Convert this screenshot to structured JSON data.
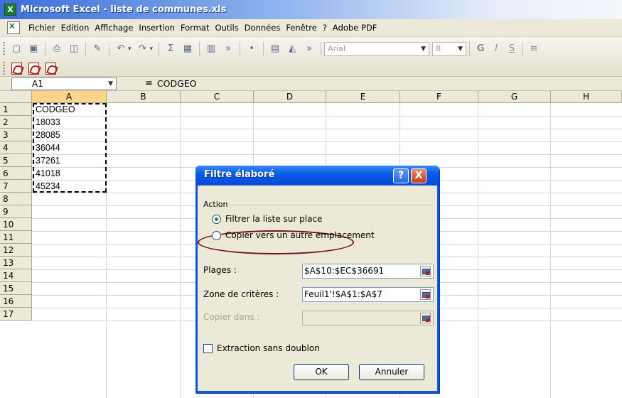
{
  "window": {
    "title": "Microsoft Excel - liste de communes.xls"
  },
  "menu": [
    "Fichier",
    "Edition",
    "Affichage",
    "Insertion",
    "Format",
    "Outils",
    "Données",
    "Fenêtre",
    "?",
    "Adobe PDF"
  ],
  "toolbar": {
    "font": "Arial",
    "size": "8",
    "bold": "G",
    "italic": "I",
    "underline": "S"
  },
  "formula_bar": {
    "cell_ref": "A1",
    "equals": "=",
    "value": "CODGEO"
  },
  "columns": [
    "A",
    "B",
    "C",
    "D",
    "E",
    "F",
    "G",
    "H"
  ],
  "rows": [
    "1",
    "2",
    "3",
    "4",
    "5",
    "6",
    "7",
    "8",
    "9",
    "10",
    "11",
    "12",
    "13",
    "14",
    "15",
    "16",
    "17"
  ],
  "cells": [
    "CODGEO",
    "18033",
    "28085",
    "36044",
    "37261",
    "41018",
    "45234"
  ],
  "dialog": {
    "title": "Filtre élaboré",
    "help": "?",
    "close": "X",
    "action_label": "Action",
    "radio1": "Filtrer la liste sur place",
    "radio2": "Copier vers un autre emplacement",
    "plages_label": "Plages :",
    "plages_value": "$A$10:$EC$36691",
    "criteres_label": "Zone de critères :",
    "criteres_value": "Feuil1'!$A$1:$A$7",
    "copier_label": "Copier dans :",
    "copier_value": "",
    "extraction_label": "Extraction sans doublon",
    "ok": "OK",
    "cancel": "Annuler"
  }
}
